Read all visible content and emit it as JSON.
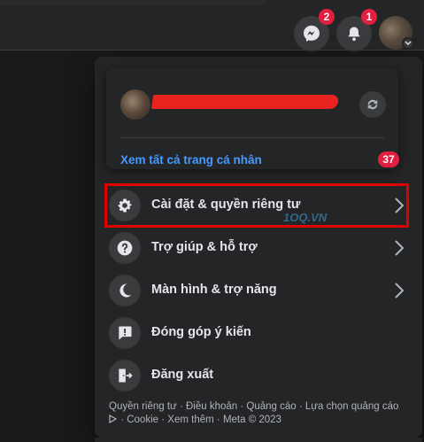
{
  "topbar": {
    "messenger_badge": "2",
    "notifications_badge": "1"
  },
  "profile_card": {
    "see_all_profiles": "Xem tất cả trang cá nhân",
    "profiles_count": "37"
  },
  "menu": {
    "items": [
      {
        "label": "Cài đặt & quyền riêng tư",
        "icon": "gear-icon",
        "has_chevron": true
      },
      {
        "label": "Trợ giúp & hỗ trợ",
        "icon": "help-icon",
        "has_chevron": true
      },
      {
        "label": "Màn hình & trợ năng",
        "icon": "moon-icon",
        "has_chevron": true
      },
      {
        "label": "Đóng góp ý kiến",
        "icon": "feedback-icon",
        "has_chevron": false
      },
      {
        "label": "Đăng xuất",
        "icon": "logout-icon",
        "has_chevron": false
      }
    ]
  },
  "footer": {
    "privacy": "Quyền riêng tư",
    "terms": "Điều khoản",
    "ads": "Quảng cáo",
    "ad_choices": "Lựa chọn quảng cáo",
    "cookie": "Cookie",
    "more": "Xem thêm",
    "copyright": "Meta © 2023",
    "sep": " · "
  },
  "watermark": "1OQ.VN",
  "colors": {
    "accent_link": "#4599ff",
    "badge_red": "#e41e3f",
    "highlight_red": "#e00000"
  }
}
